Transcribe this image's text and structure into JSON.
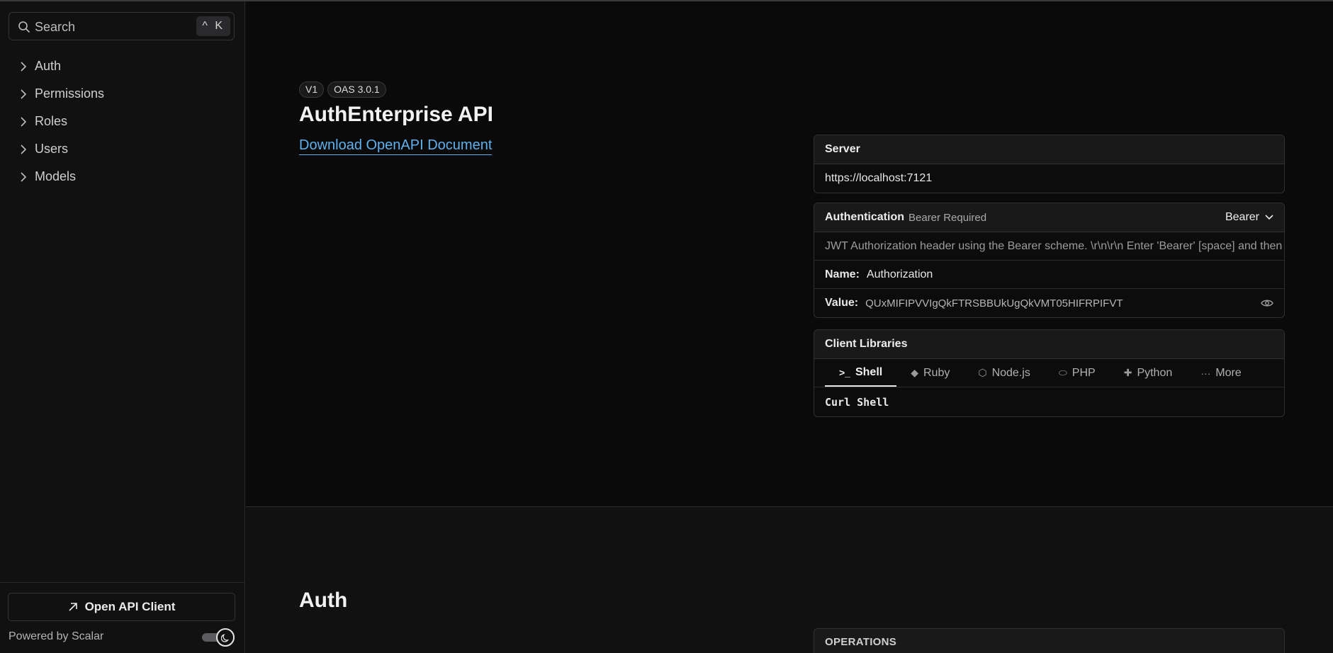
{
  "search": {
    "placeholder": "Search",
    "shortcut": "^ K"
  },
  "sidebar": {
    "items": [
      {
        "label": "Auth"
      },
      {
        "label": "Permissions"
      },
      {
        "label": "Roles"
      },
      {
        "label": "Users"
      },
      {
        "label": "Models"
      }
    ],
    "api_client_label": "Open API Client",
    "powered_by": "Powered by Scalar",
    "dark_mode": true
  },
  "header": {
    "version_badge": "V1",
    "oas_badge": "OAS 3.0.1",
    "title": "AuthEnterprise API",
    "download_link": "Download OpenAPI Document"
  },
  "server": {
    "title": "Server",
    "url": "https://localhost:7121"
  },
  "authentication": {
    "title": "Authentication",
    "subtitle": "Bearer Required",
    "scheme": "Bearer",
    "description": "JWT Authorization header using the Bearer scheme. \\r\\n\\r\\n Enter 'Bearer' [space] and then your token",
    "name_label": "Name:",
    "name_value": "Authorization",
    "value_label": "Value:",
    "value_masked": "QUxMIFIPVVIgQkFTRSBBUkUgQkVMT05HIFRPIFVT"
  },
  "client_libraries": {
    "title": "Client Libraries",
    "tabs": [
      {
        "label": "Shell",
        "icon": "terminal-icon",
        "active": true
      },
      {
        "label": "Ruby",
        "icon": "ruby-icon",
        "active": false
      },
      {
        "label": "Node.js",
        "icon": "nodejs-icon",
        "active": false
      },
      {
        "label": "PHP",
        "icon": "php-icon",
        "active": false
      },
      {
        "label": "Python",
        "icon": "python-icon",
        "active": false
      },
      {
        "label": "More",
        "icon": "more-icon",
        "active": false
      }
    ],
    "selected_client": "Curl Shell"
  },
  "section": {
    "heading": "Auth",
    "operations_label": "OPERATIONS"
  },
  "colors": {
    "background": "#0a0a0b",
    "sidebar": "#111112",
    "link": "#5fb0ec"
  }
}
